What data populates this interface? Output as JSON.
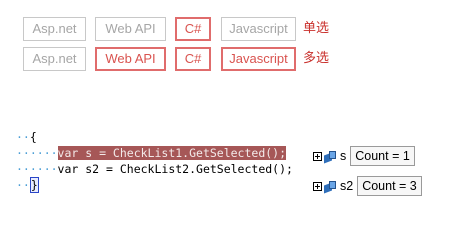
{
  "single_select": {
    "options": [
      {
        "label": "Asp.net",
        "selected": false
      },
      {
        "label": "Web API",
        "selected": false
      },
      {
        "label": "C#",
        "selected": true
      },
      {
        "label": "Javascript",
        "selected": false
      }
    ],
    "label": "单选"
  },
  "multi_select": {
    "options": [
      {
        "label": "Asp.net",
        "selected": false
      },
      {
        "label": "Web API",
        "selected": true
      },
      {
        "label": "C#",
        "selected": true
      },
      {
        "label": "Javascript",
        "selected": true
      }
    ],
    "label": "多选"
  },
  "code": {
    "line1": "{",
    "line2": "var s = CheckList1.GetSelected();",
    "line3": "var s2 = CheckList2.GetSelected();",
    "line4": "}"
  },
  "datatips": [
    {
      "name": "s",
      "value": "Count = 1"
    },
    {
      "name": "s2",
      "value": "Count = 3"
    }
  ],
  "colors": {
    "selected_border": "#e06c6c",
    "selected_text": "#d9534f",
    "highlight": "#a65757"
  }
}
